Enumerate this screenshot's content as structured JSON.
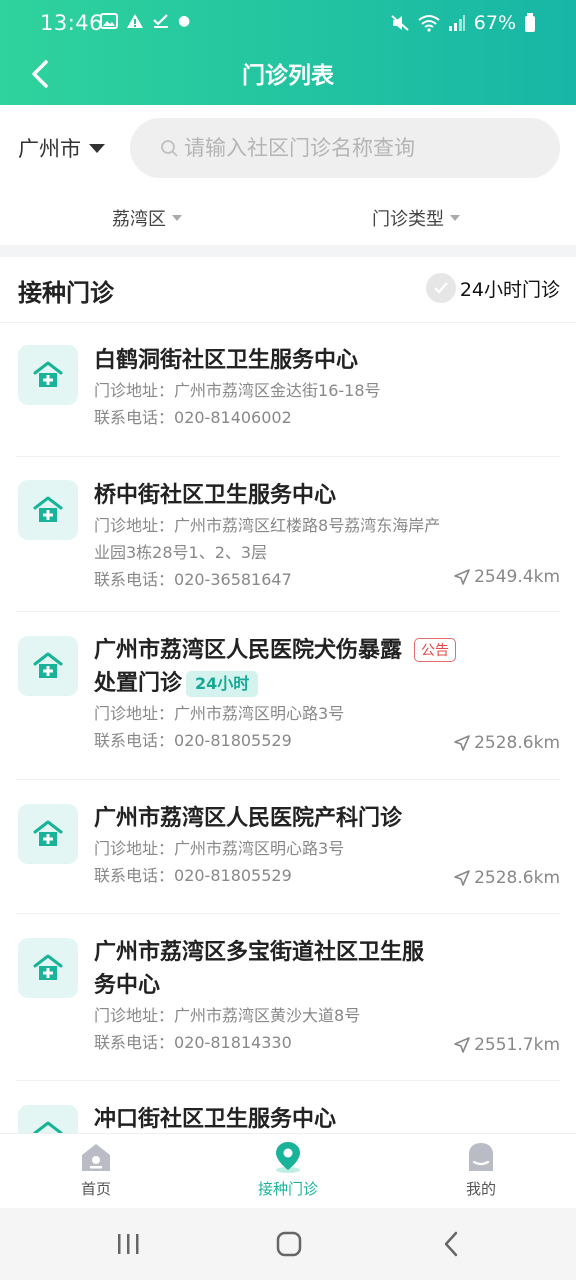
{
  "status": {
    "time": "13:46",
    "battery": "67%"
  },
  "header": {
    "title": "门诊列表"
  },
  "filters": {
    "city": "广州市",
    "search_placeholder": "请输入社区门诊名称查询",
    "district": "荔湾区",
    "clinic_type": "门诊类型"
  },
  "section": {
    "title": "接种门诊",
    "toggle_label": "24小时门诊"
  },
  "clinics": [
    {
      "name": "白鹤洞街社区卫生服务中心",
      "address_label": "门诊地址：",
      "address": "广州市荔湾区金达街16-18号",
      "phone_label": "联系电话：",
      "phone": "020-81406002",
      "distance": ""
    },
    {
      "name": "桥中街社区卫生服务中心",
      "address_label": "门诊地址：",
      "address": "广州市荔湾区红楼路8号荔湾东海岸产业园3栋28号1、2、3层",
      "phone_label": "联系电话：",
      "phone": "020-36581647",
      "distance": "2549.4km"
    },
    {
      "name": "广州市荔湾区人民医院犬伤暴露处置门诊",
      "tag": "24小时",
      "notice": "公告",
      "address_label": "门诊地址：",
      "address": "广州市荔湾区明心路3号",
      "phone_label": "联系电话：",
      "phone": "020-81805529",
      "distance": "2528.6km"
    },
    {
      "name": "广州市荔湾区人民医院产科门诊",
      "address_label": "门诊地址：",
      "address": "广州市荔湾区明心路3号",
      "phone_label": "联系电话：",
      "phone": "020-81805529",
      "distance": "2528.6km"
    },
    {
      "name": "广州市荔湾区多宝街道社区卫生服务中心",
      "address_label": "门诊地址：",
      "address": "广州市荔湾区黄沙大道8号",
      "phone_label": "联系电话：",
      "phone": "020-81814330",
      "distance": "2551.7km"
    },
    {
      "name": "冲口街社区卫生服务中心"
    }
  ],
  "tabs": [
    {
      "label": "首页",
      "icon": "home-icon"
    },
    {
      "label": "接种门诊",
      "icon": "location-pin-icon"
    },
    {
      "label": "我的",
      "icon": "profile-icon"
    }
  ],
  "colors": {
    "accent": "#19b39a",
    "header_start": "#2fd39c",
    "header_end": "#17b6a6",
    "notice": "#e24a4a"
  }
}
